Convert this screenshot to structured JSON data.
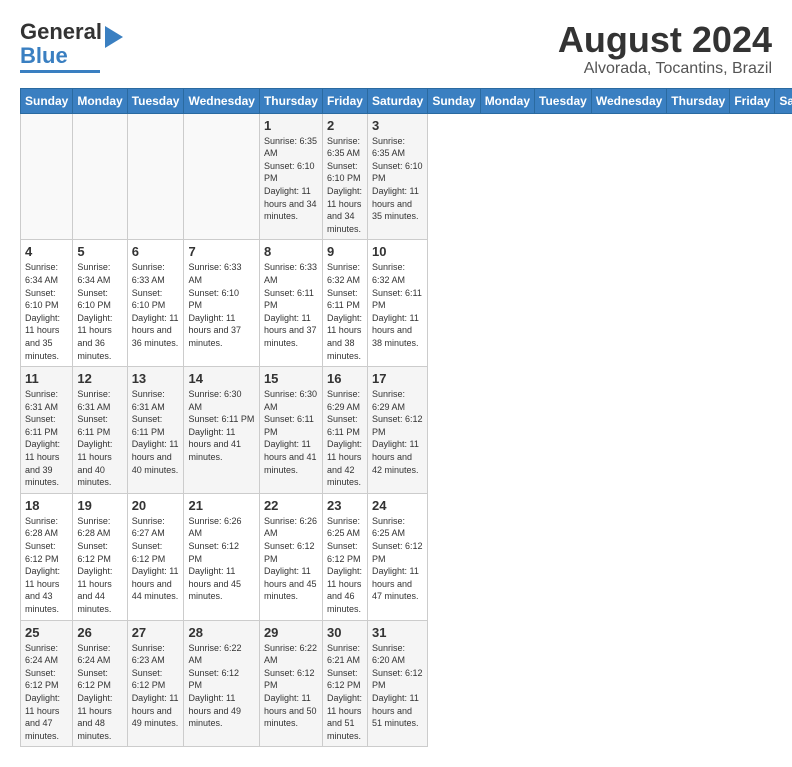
{
  "header": {
    "logo_general": "General",
    "logo_blue": "Blue",
    "month": "August 2024",
    "location": "Alvorada, Tocantins, Brazil"
  },
  "days_of_week": [
    "Sunday",
    "Monday",
    "Tuesday",
    "Wednesday",
    "Thursday",
    "Friday",
    "Saturday"
  ],
  "weeks": [
    [
      {
        "day": "",
        "sunrise": "",
        "sunset": "",
        "daylight": ""
      },
      {
        "day": "",
        "sunrise": "",
        "sunset": "",
        "daylight": ""
      },
      {
        "day": "",
        "sunrise": "",
        "sunset": "",
        "daylight": ""
      },
      {
        "day": "",
        "sunrise": "",
        "sunset": "",
        "daylight": ""
      },
      {
        "day": "1",
        "sunrise": "Sunrise: 6:35 AM",
        "sunset": "Sunset: 6:10 PM",
        "daylight": "Daylight: 11 hours and 34 minutes."
      },
      {
        "day": "2",
        "sunrise": "Sunrise: 6:35 AM",
        "sunset": "Sunset: 6:10 PM",
        "daylight": "Daylight: 11 hours and 34 minutes."
      },
      {
        "day": "3",
        "sunrise": "Sunrise: 6:35 AM",
        "sunset": "Sunset: 6:10 PM",
        "daylight": "Daylight: 11 hours and 35 minutes."
      }
    ],
    [
      {
        "day": "4",
        "sunrise": "Sunrise: 6:34 AM",
        "sunset": "Sunset: 6:10 PM",
        "daylight": "Daylight: 11 hours and 35 minutes."
      },
      {
        "day": "5",
        "sunrise": "Sunrise: 6:34 AM",
        "sunset": "Sunset: 6:10 PM",
        "daylight": "Daylight: 11 hours and 36 minutes."
      },
      {
        "day": "6",
        "sunrise": "Sunrise: 6:33 AM",
        "sunset": "Sunset: 6:10 PM",
        "daylight": "Daylight: 11 hours and 36 minutes."
      },
      {
        "day": "7",
        "sunrise": "Sunrise: 6:33 AM",
        "sunset": "Sunset: 6:10 PM",
        "daylight": "Daylight: 11 hours and 37 minutes."
      },
      {
        "day": "8",
        "sunrise": "Sunrise: 6:33 AM",
        "sunset": "Sunset: 6:11 PM",
        "daylight": "Daylight: 11 hours and 37 minutes."
      },
      {
        "day": "9",
        "sunrise": "Sunrise: 6:32 AM",
        "sunset": "Sunset: 6:11 PM",
        "daylight": "Daylight: 11 hours and 38 minutes."
      },
      {
        "day": "10",
        "sunrise": "Sunrise: 6:32 AM",
        "sunset": "Sunset: 6:11 PM",
        "daylight": "Daylight: 11 hours and 38 minutes."
      }
    ],
    [
      {
        "day": "11",
        "sunrise": "Sunrise: 6:31 AM",
        "sunset": "Sunset: 6:11 PM",
        "daylight": "Daylight: 11 hours and 39 minutes."
      },
      {
        "day": "12",
        "sunrise": "Sunrise: 6:31 AM",
        "sunset": "Sunset: 6:11 PM",
        "daylight": "Daylight: 11 hours and 40 minutes."
      },
      {
        "day": "13",
        "sunrise": "Sunrise: 6:31 AM",
        "sunset": "Sunset: 6:11 PM",
        "daylight": "Daylight: 11 hours and 40 minutes."
      },
      {
        "day": "14",
        "sunrise": "Sunrise: 6:30 AM",
        "sunset": "Sunset: 6:11 PM",
        "daylight": "Daylight: 11 hours and 41 minutes."
      },
      {
        "day": "15",
        "sunrise": "Sunrise: 6:30 AM",
        "sunset": "Sunset: 6:11 PM",
        "daylight": "Daylight: 11 hours and 41 minutes."
      },
      {
        "day": "16",
        "sunrise": "Sunrise: 6:29 AM",
        "sunset": "Sunset: 6:11 PM",
        "daylight": "Daylight: 11 hours and 42 minutes."
      },
      {
        "day": "17",
        "sunrise": "Sunrise: 6:29 AM",
        "sunset": "Sunset: 6:12 PM",
        "daylight": "Daylight: 11 hours and 42 minutes."
      }
    ],
    [
      {
        "day": "18",
        "sunrise": "Sunrise: 6:28 AM",
        "sunset": "Sunset: 6:12 PM",
        "daylight": "Daylight: 11 hours and 43 minutes."
      },
      {
        "day": "19",
        "sunrise": "Sunrise: 6:28 AM",
        "sunset": "Sunset: 6:12 PM",
        "daylight": "Daylight: 11 hours and 44 minutes."
      },
      {
        "day": "20",
        "sunrise": "Sunrise: 6:27 AM",
        "sunset": "Sunset: 6:12 PM",
        "daylight": "Daylight: 11 hours and 44 minutes."
      },
      {
        "day": "21",
        "sunrise": "Sunrise: 6:26 AM",
        "sunset": "Sunset: 6:12 PM",
        "daylight": "Daylight: 11 hours and 45 minutes."
      },
      {
        "day": "22",
        "sunrise": "Sunrise: 6:26 AM",
        "sunset": "Sunset: 6:12 PM",
        "daylight": "Daylight: 11 hours and 45 minutes."
      },
      {
        "day": "23",
        "sunrise": "Sunrise: 6:25 AM",
        "sunset": "Sunset: 6:12 PM",
        "daylight": "Daylight: 11 hours and 46 minutes."
      },
      {
        "day": "24",
        "sunrise": "Sunrise: 6:25 AM",
        "sunset": "Sunset: 6:12 PM",
        "daylight": "Daylight: 11 hours and 47 minutes."
      }
    ],
    [
      {
        "day": "25",
        "sunrise": "Sunrise: 6:24 AM",
        "sunset": "Sunset: 6:12 PM",
        "daylight": "Daylight: 11 hours and 47 minutes."
      },
      {
        "day": "26",
        "sunrise": "Sunrise: 6:24 AM",
        "sunset": "Sunset: 6:12 PM",
        "daylight": "Daylight: 11 hours and 48 minutes."
      },
      {
        "day": "27",
        "sunrise": "Sunrise: 6:23 AM",
        "sunset": "Sunset: 6:12 PM",
        "daylight": "Daylight: 11 hours and 49 minutes."
      },
      {
        "day": "28",
        "sunrise": "Sunrise: 6:22 AM",
        "sunset": "Sunset: 6:12 PM",
        "daylight": "Daylight: 11 hours and 49 minutes."
      },
      {
        "day": "29",
        "sunrise": "Sunrise: 6:22 AM",
        "sunset": "Sunset: 6:12 PM",
        "daylight": "Daylight: 11 hours and 50 minutes."
      },
      {
        "day": "30",
        "sunrise": "Sunrise: 6:21 AM",
        "sunset": "Sunset: 6:12 PM",
        "daylight": "Daylight: 11 hours and 51 minutes."
      },
      {
        "day": "31",
        "sunrise": "Sunrise: 6:20 AM",
        "sunset": "Sunset: 6:12 PM",
        "daylight": "Daylight: 11 hours and 51 minutes."
      }
    ]
  ]
}
